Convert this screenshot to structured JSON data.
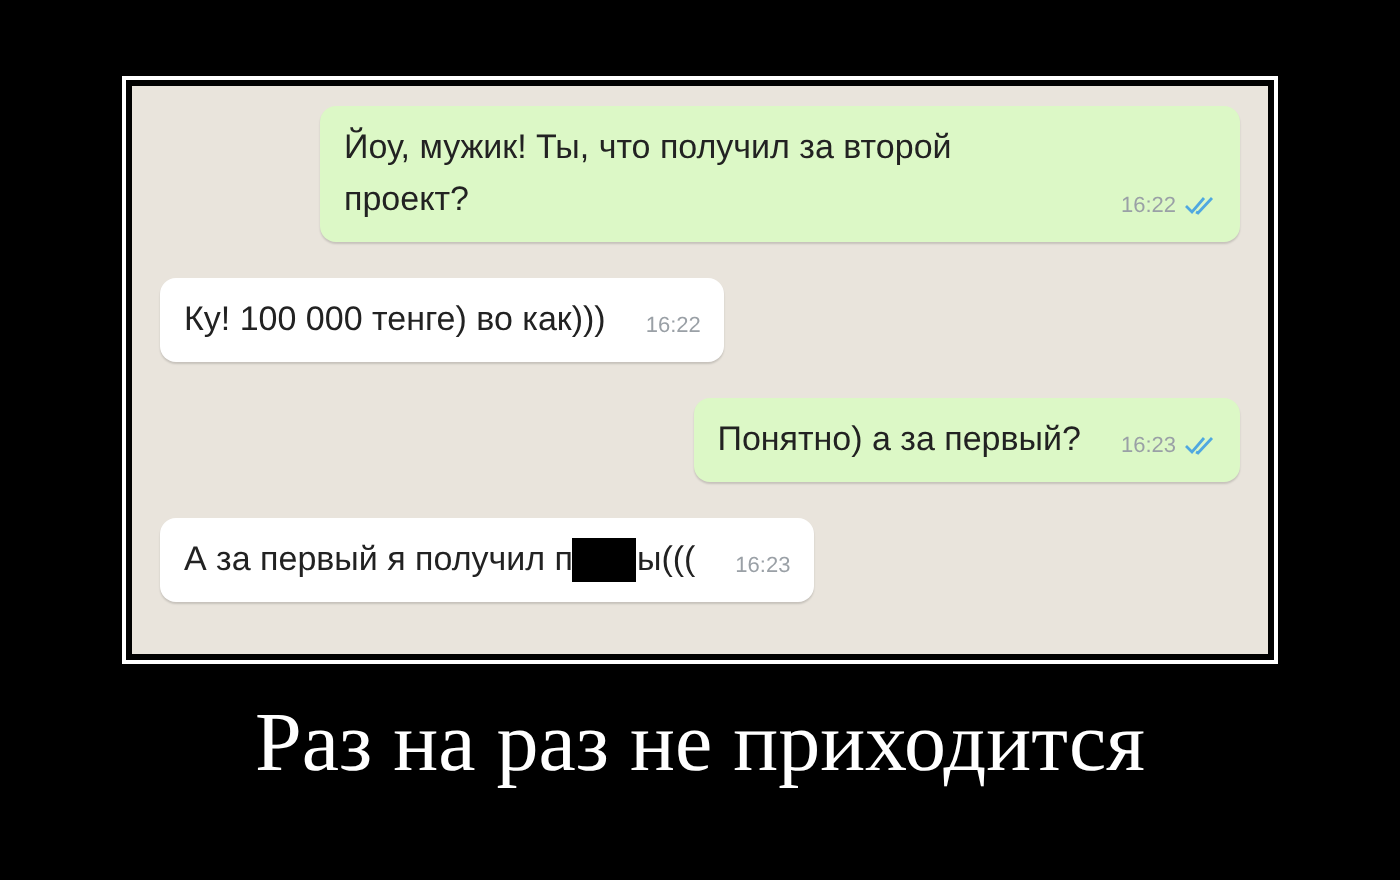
{
  "messages": [
    {
      "kind": "out",
      "text": "Йоу, мужик! Ты, что получил за второй проект?",
      "time": "16:22",
      "read": true
    },
    {
      "kind": "in",
      "text": "Ку! 100 000 тенге) во как)))",
      "time": "16:22"
    },
    {
      "kind": "out",
      "text": "Понятно) а за первый?",
      "time": "16:23",
      "read": true
    },
    {
      "kind": "in",
      "text": "А за первый я получил п",
      "text_after": "ы(((",
      "censored": true,
      "time": "16:23"
    }
  ],
  "caption": "Раз на раз не приходится"
}
